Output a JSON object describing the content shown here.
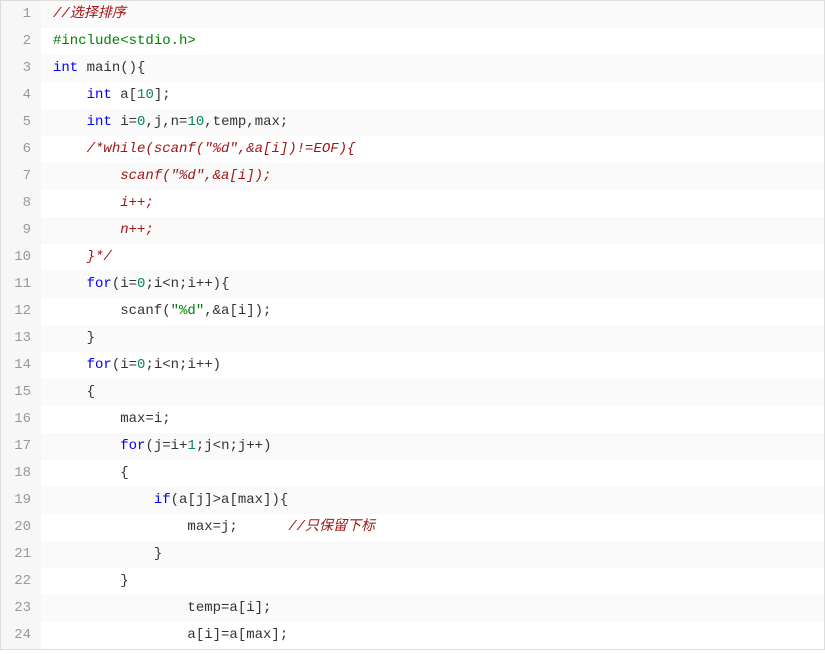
{
  "lines": [
    {
      "num": 1,
      "hl": true,
      "tokens": [
        {
          "cls": "comment",
          "t": "//选择排序"
        }
      ]
    },
    {
      "num": 2,
      "hl": false,
      "tokens": [
        {
          "cls": "preproc",
          "t": "#include<stdio.h>"
        }
      ]
    },
    {
      "num": 3,
      "hl": true,
      "tokens": [
        {
          "cls": "type",
          "t": "int"
        },
        {
          "cls": "plain",
          "t": " main(){"
        }
      ]
    },
    {
      "num": 4,
      "hl": false,
      "tokens": [
        {
          "cls": "plain",
          "t": "    "
        },
        {
          "cls": "type",
          "t": "int"
        },
        {
          "cls": "plain",
          "t": " a["
        },
        {
          "cls": "num",
          "t": "10"
        },
        {
          "cls": "plain",
          "t": "];"
        }
      ]
    },
    {
      "num": 5,
      "hl": true,
      "tokens": [
        {
          "cls": "plain",
          "t": "    "
        },
        {
          "cls": "type",
          "t": "int"
        },
        {
          "cls": "plain",
          "t": " i="
        },
        {
          "cls": "num",
          "t": "0"
        },
        {
          "cls": "plain",
          "t": ",j,n="
        },
        {
          "cls": "num",
          "t": "10"
        },
        {
          "cls": "plain",
          "t": ",temp,max;"
        }
      ]
    },
    {
      "num": 6,
      "hl": false,
      "tokens": [
        {
          "cls": "plain",
          "t": "    "
        },
        {
          "cls": "comment",
          "t": "/*while(scanf(\"%d\",&a[i])!=EOF){"
        }
      ]
    },
    {
      "num": 7,
      "hl": true,
      "tokens": [
        {
          "cls": "plain",
          "t": "        "
        },
        {
          "cls": "comment",
          "t": "scanf(\"%d\",&a[i]);"
        }
      ]
    },
    {
      "num": 8,
      "hl": false,
      "tokens": [
        {
          "cls": "plain",
          "t": "        "
        },
        {
          "cls": "comment",
          "t": "i++;"
        }
      ]
    },
    {
      "num": 9,
      "hl": true,
      "tokens": [
        {
          "cls": "plain",
          "t": "        "
        },
        {
          "cls": "comment",
          "t": "n++;"
        }
      ]
    },
    {
      "num": 10,
      "hl": false,
      "tokens": [
        {
          "cls": "plain",
          "t": "    "
        },
        {
          "cls": "comment",
          "t": "}*/"
        }
      ]
    },
    {
      "num": 11,
      "hl": true,
      "tokens": [
        {
          "cls": "plain",
          "t": "    "
        },
        {
          "cls": "keyword",
          "t": "for"
        },
        {
          "cls": "plain",
          "t": "(i="
        },
        {
          "cls": "num",
          "t": "0"
        },
        {
          "cls": "plain",
          "t": ";i<n;i++){"
        }
      ]
    },
    {
      "num": 12,
      "hl": false,
      "tokens": [
        {
          "cls": "plain",
          "t": "        scanf("
        },
        {
          "cls": "string",
          "t": "\"%d\""
        },
        {
          "cls": "plain",
          "t": ",&a[i]);"
        }
      ]
    },
    {
      "num": 13,
      "hl": true,
      "tokens": [
        {
          "cls": "plain",
          "t": "    }"
        }
      ]
    },
    {
      "num": 14,
      "hl": false,
      "tokens": [
        {
          "cls": "plain",
          "t": "    "
        },
        {
          "cls": "keyword",
          "t": "for"
        },
        {
          "cls": "plain",
          "t": "(i="
        },
        {
          "cls": "num",
          "t": "0"
        },
        {
          "cls": "plain",
          "t": ";i<n;i++)"
        }
      ]
    },
    {
      "num": 15,
      "hl": true,
      "tokens": [
        {
          "cls": "plain",
          "t": "    {"
        }
      ]
    },
    {
      "num": 16,
      "hl": false,
      "tokens": [
        {
          "cls": "plain",
          "t": "        max=i;"
        }
      ]
    },
    {
      "num": 17,
      "hl": true,
      "tokens": [
        {
          "cls": "plain",
          "t": "        "
        },
        {
          "cls": "keyword",
          "t": "for"
        },
        {
          "cls": "plain",
          "t": "(j=i+"
        },
        {
          "cls": "num",
          "t": "1"
        },
        {
          "cls": "plain",
          "t": ";j<n;j++)"
        }
      ]
    },
    {
      "num": 18,
      "hl": false,
      "tokens": [
        {
          "cls": "plain",
          "t": "        {"
        }
      ]
    },
    {
      "num": 19,
      "hl": true,
      "tokens": [
        {
          "cls": "plain",
          "t": "            "
        },
        {
          "cls": "keyword",
          "t": "if"
        },
        {
          "cls": "plain",
          "t": "(a[j]>a[max]){"
        }
      ]
    },
    {
      "num": 20,
      "hl": false,
      "tokens": [
        {
          "cls": "plain",
          "t": "                max=j;      "
        },
        {
          "cls": "comment",
          "t": "//只保留下标"
        }
      ]
    },
    {
      "num": 21,
      "hl": true,
      "tokens": [
        {
          "cls": "plain",
          "t": "            }"
        }
      ]
    },
    {
      "num": 22,
      "hl": false,
      "tokens": [
        {
          "cls": "plain",
          "t": "        }"
        }
      ]
    },
    {
      "num": 23,
      "hl": true,
      "tokens": [
        {
          "cls": "plain",
          "t": "                temp=a[i];"
        }
      ]
    },
    {
      "num": 24,
      "hl": false,
      "tokens": [
        {
          "cls": "plain",
          "t": "                a[i]=a[max];"
        }
      ]
    }
  ]
}
